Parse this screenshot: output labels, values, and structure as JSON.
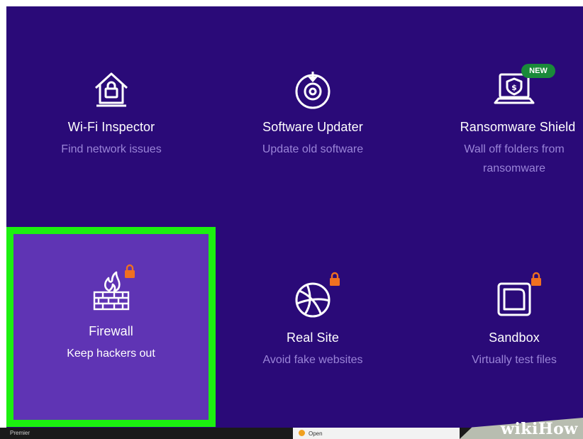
{
  "features": [
    {
      "key": "wifi",
      "title": "Wi-Fi Inspector",
      "desc": [
        "Find network issues"
      ],
      "icon": "house-lock-icon",
      "locked": false,
      "selected": false
    },
    {
      "key": "updater",
      "title": "Software Updater",
      "desc": [
        "Update old software"
      ],
      "icon": "disc-download-icon",
      "locked": false,
      "selected": false
    },
    {
      "key": "ransom",
      "title": "Ransomware Shield",
      "desc": [
        "Wall off folders from",
        "ransomware"
      ],
      "icon": "laptop-shield-icon",
      "locked": false,
      "selected": false,
      "badge": "NEW"
    },
    {
      "key": "firewall",
      "title": "Firewall",
      "desc": [
        "Keep hackers out"
      ],
      "icon": "brick-wall-fire-icon",
      "locked": true,
      "selected": true
    },
    {
      "key": "realsite",
      "title": "Real Site",
      "desc": [
        "Avoid fake websites"
      ],
      "icon": "globe-icon",
      "locked": true,
      "selected": false
    },
    {
      "key": "sandbox",
      "title": "Sandbox",
      "desc": [
        "Virtually test files"
      ],
      "icon": "sandbox-box-icon",
      "locked": true,
      "selected": false
    }
  ],
  "taskbar": {
    "premier_label": "Premier",
    "open_label": "Open"
  },
  "watermark": "wikiHow",
  "colors": {
    "background": "#2a0a78",
    "highlight_fill": "#5f34b4",
    "highlight_border": "#1cf010",
    "description": "#9a84d8",
    "lock": "#f07020",
    "badge": "#1a8a3a"
  }
}
